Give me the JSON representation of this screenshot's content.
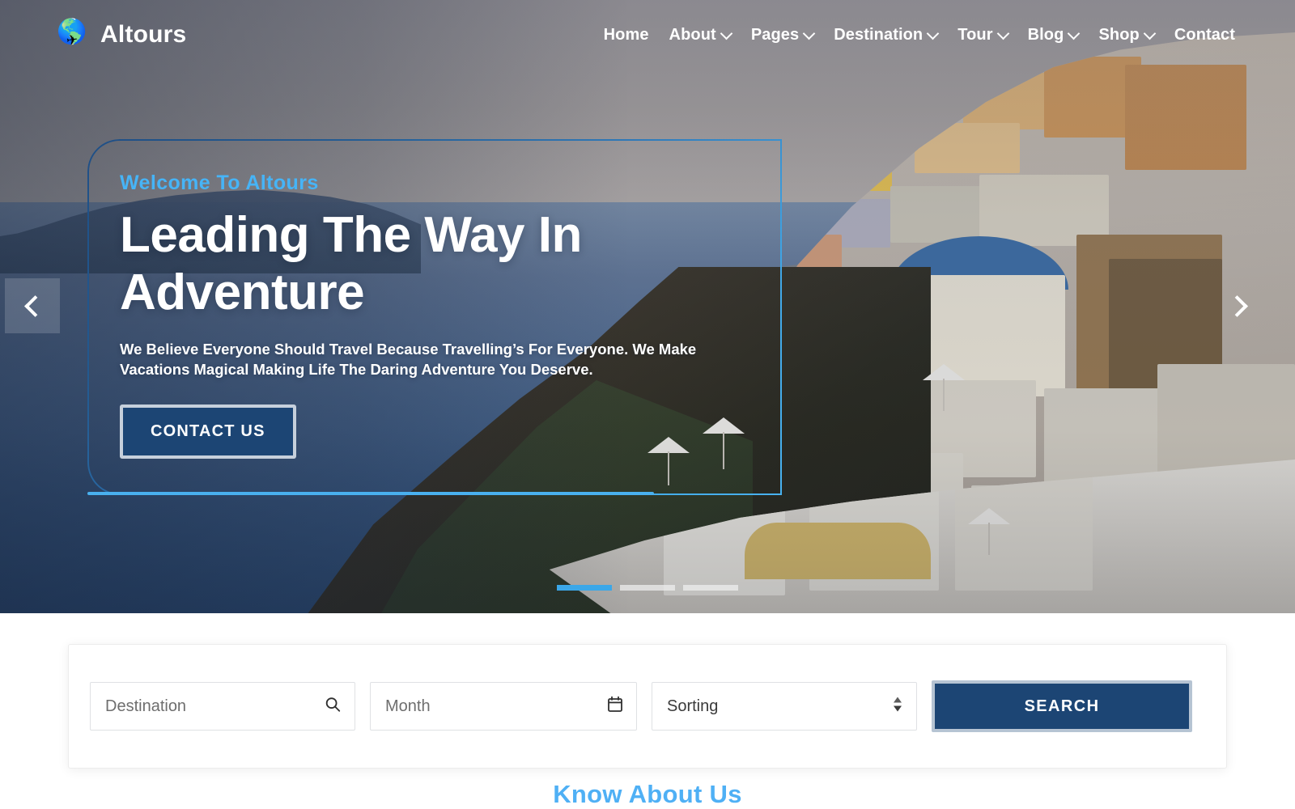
{
  "brand": {
    "name": "Altours",
    "logo_icon": "globe-airplane-icon",
    "globe_glyph": "🌎",
    "plane_glyph": "✈",
    "accent_blue": "#3ba7e8",
    "navy": "#1c4574"
  },
  "nav": {
    "items": [
      {
        "label": "Home",
        "has_dropdown": false
      },
      {
        "label": "About",
        "has_dropdown": true
      },
      {
        "label": "Pages",
        "has_dropdown": true
      },
      {
        "label": "Destination",
        "has_dropdown": true
      },
      {
        "label": "Tour",
        "has_dropdown": true
      },
      {
        "label": "Blog",
        "has_dropdown": true
      },
      {
        "label": "Shop",
        "has_dropdown": true
      },
      {
        "label": "Contact",
        "has_dropdown": false
      }
    ]
  },
  "hero": {
    "eyebrow": "Welcome To Altours",
    "title": "Leading The Way In Adventure",
    "subtitle": "We Believe Everyone Should Travel Because Travelling’s For Everyone. We Make Vacations Magical Making Life The Daring Adventure You Deserve.",
    "cta_label": "CONTACT US",
    "prev_label": "‹",
    "next_label": "›",
    "slide_count": 3,
    "active_slide": 1
  },
  "search": {
    "destination_placeholder": "Destination",
    "destination_value": "",
    "month_placeholder": "Month",
    "month_value": "",
    "sorting_selected": "Sorting",
    "sorting_options": [
      "Sorting"
    ],
    "button_label": "SEARCH"
  },
  "about": {
    "eyebrow": "Know About Us"
  }
}
